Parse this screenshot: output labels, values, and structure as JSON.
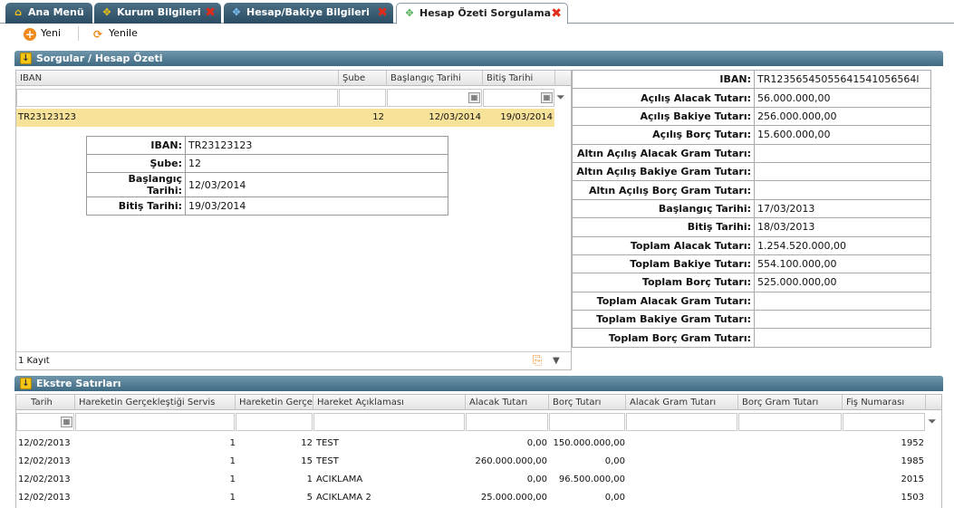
{
  "tabs": [
    {
      "label": "Ana Menü",
      "icon": "home-icon",
      "closable": false
    },
    {
      "label": "Kurum Bilgileri",
      "icon": "compass-icon",
      "closable": true
    },
    {
      "label": "Hesap/Bakiye Bilgileri",
      "icon": "compass-icon",
      "closable": true
    },
    {
      "label": "Hesap Özeti Sorgulama",
      "icon": "compass-icon",
      "closable": true,
      "active": true
    }
  ],
  "toolbar": {
    "new_label": "Yeni",
    "refresh_label": "Yenile"
  },
  "section1": {
    "title": "Sorgular / Hesap Özeti"
  },
  "query_grid": {
    "columns": [
      "IBAN",
      "Şube",
      "Başlangıç Tarihi",
      "Bitiş Tarihi"
    ],
    "rows": [
      {
        "iban": "TR23123123",
        "sube": "12",
        "baslangic": "12/03/2014",
        "bitis": "19/03/2014"
      }
    ],
    "record_count": "1 Kayıt"
  },
  "detail": [
    {
      "label": "IBAN:",
      "value": "TR23123123"
    },
    {
      "label": "Şube:",
      "value": "12"
    },
    {
      "label": "Başlangıç Tarihi:",
      "value": "12/03/2014"
    },
    {
      "label": "Bitiş Tarihi:",
      "value": "19/03/2014"
    }
  ],
  "summary": [
    {
      "label": "IBAN:",
      "value": "TR12356545055641541056564l"
    },
    {
      "label": "Açılış Alacak Tutarı:",
      "value": "56.000.000,00"
    },
    {
      "label": "Açılış Bakiye Tutarı:",
      "value": "256.000.000,00"
    },
    {
      "label": "Açılış Borç Tutarı:",
      "value": "15.600.000,00"
    },
    {
      "label": "Altın Açılış Alacak Gram Tutarı:",
      "value": ""
    },
    {
      "label": "Altın Açılış Bakiye Gram Tutarı:",
      "value": ""
    },
    {
      "label": "Altın Açılış Borç Gram Tutarı:",
      "value": ""
    },
    {
      "label": "Başlangıç Tarihi:",
      "value": "17/03/2013"
    },
    {
      "label": "Bitiş Tarihi:",
      "value": "18/03/2013"
    },
    {
      "label": "Toplam Alacak Tutarı:",
      "value": "1.254.520.000,00"
    },
    {
      "label": "Toplam Bakiye Tutarı:",
      "value": "554.100.000,00"
    },
    {
      "label": "Toplam Borç Tutarı:",
      "value": "525.000.000,00"
    },
    {
      "label": "Toplam Alacak Gram Tutarı:",
      "value": ""
    },
    {
      "label": "Toplam Bakiye Gram Tutarı:",
      "value": ""
    },
    {
      "label": "Toplam Borç Gram Tutarı:",
      "value": ""
    }
  ],
  "section2": {
    "title": "Ekstre Satırları"
  },
  "statement_grid": {
    "columns": [
      "Tarih",
      "Hareketin Gerçekleştiği Servis",
      "Hareketin Gerçe",
      "Hareket Açıklaması",
      "Alacak Tutarı",
      "Borç Tutarı",
      "Alacak Gram Tutarı",
      "Borç Gram Tutarı",
      "Fiş Numarası"
    ],
    "rows": [
      {
        "tarih": "12/02/2013",
        "servis": "1",
        "gerce": "12",
        "aciklama": "TEST",
        "alacak": "0,00",
        "borc": "150.000.000,00",
        "fis": "1952"
      },
      {
        "tarih": "12/02/2013",
        "servis": "1",
        "gerce": "15",
        "aciklama": "TEST",
        "alacak": "260.000.000,00",
        "borc": "0,00",
        "fis": "1985"
      },
      {
        "tarih": "12/02/2013",
        "servis": "1",
        "gerce": "1",
        "aciklama": "ACIKLAMA",
        "alacak": "0,00",
        "borc": "96.500.000,00",
        "fis": "2015"
      },
      {
        "tarih": "12/02/2013",
        "servis": "1",
        "gerce": "5",
        "aciklama": "ACIKLAMA 2",
        "alacak": "25.000.000,00",
        "borc": "0,00",
        "fis": "1503"
      }
    ]
  },
  "colors": {
    "tab_bg": "#2b4c62",
    "section_bg": "#3f6b83",
    "selected_row": "#f7e29a",
    "close_red": "#e12a17"
  }
}
